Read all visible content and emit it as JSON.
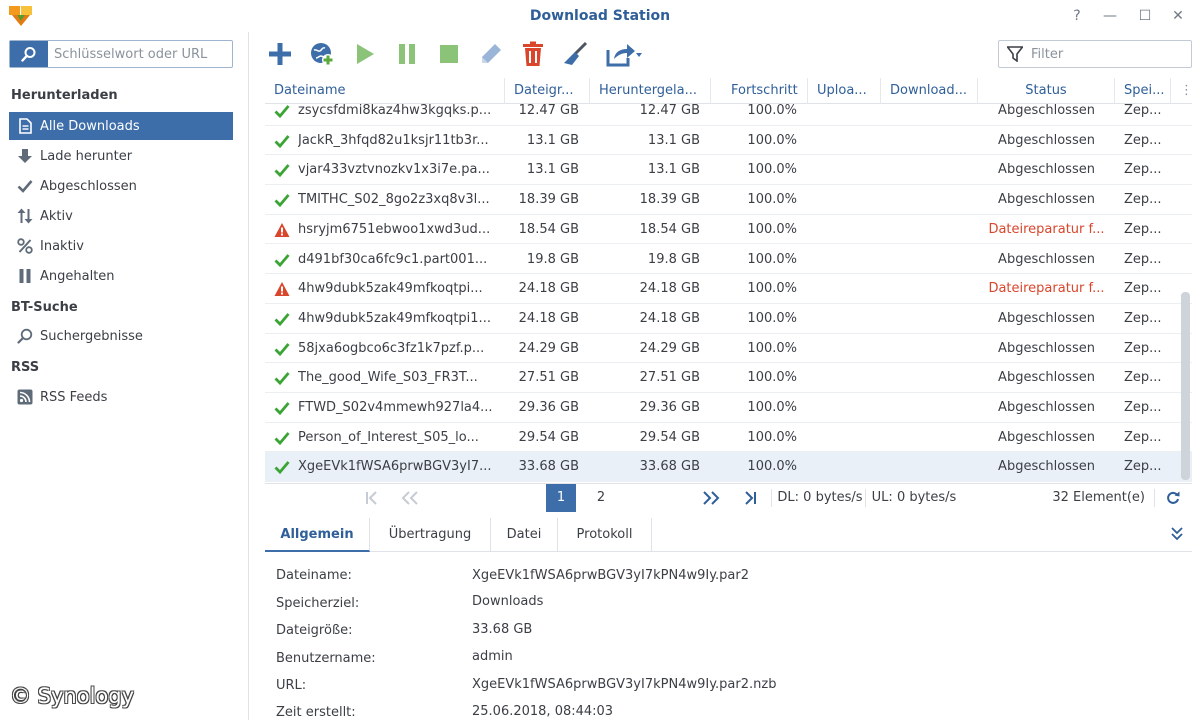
{
  "app": {
    "title": "Download Station",
    "window_buttons": {
      "help": "?",
      "minimize": "—",
      "maximize": "☐",
      "close": "✕"
    }
  },
  "search": {
    "placeholder": "Schlüsselwort oder URL"
  },
  "sidebar": {
    "sections": [
      {
        "label": "Herunterladen"
      },
      {
        "label": "BT-Suche"
      },
      {
        "label": "RSS"
      }
    ],
    "items": [
      {
        "label": "Alle Downloads",
        "icon": "document-icon"
      },
      {
        "label": "Lade herunter",
        "icon": "arrow-down-icon"
      },
      {
        "label": "Abgeschlossen",
        "icon": "checkmark-icon"
      },
      {
        "label": "Aktiv",
        "icon": "up-down-arrows-icon"
      },
      {
        "label": "Inaktiv",
        "icon": "percent-icon"
      },
      {
        "label": "Angehalten",
        "icon": "pause-icon"
      },
      {
        "label": "Suchergebnisse",
        "icon": "magnifier-icon"
      },
      {
        "label": "RSS Feeds",
        "icon": "rss-icon"
      }
    ],
    "active_item": "Alle Downloads"
  },
  "toolbar": {
    "buttons": [
      "add-icon",
      "add-url-icon",
      "resume-icon",
      "pause-icon",
      "stop-icon",
      "edit-icon",
      "delete-icon",
      "clear-completed-icon",
      "share-icon"
    ],
    "filter_placeholder": "Filter"
  },
  "grid": {
    "columns": [
      "Dateiname",
      "Dateigr...",
      "Heruntergela...",
      "Fortschritt",
      "Uploa...",
      "Download...",
      "Status",
      "Spei..."
    ],
    "rows": [
      {
        "name": "zsycsfdmi8kaz4hw3kgqks.p...",
        "size": "12.47 GB",
        "downloaded": "12.47 GB",
        "progress": "100.0%",
        "upload": "",
        "download": "",
        "status": "Abgeschlossen",
        "dest": "Zep...",
        "state": "ok"
      },
      {
        "name": "JackR_3hfqd82u1ksjr11tb3r...",
        "size": "13.1 GB",
        "downloaded": "13.1 GB",
        "progress": "100.0%",
        "upload": "",
        "download": "",
        "status": "Abgeschlossen",
        "dest": "Zep...",
        "state": "ok"
      },
      {
        "name": "vjar433vztvnozkv1x3i7e.pa...",
        "size": "13.1 GB",
        "downloaded": "13.1 GB",
        "progress": "100.0%",
        "upload": "",
        "download": "",
        "status": "Abgeschlossen",
        "dest": "Zep...",
        "state": "ok"
      },
      {
        "name": "TMITHC_S02_8go2z3xq8v3l...",
        "size": "18.39 GB",
        "downloaded": "18.39 GB",
        "progress": "100.0%",
        "upload": "",
        "download": "",
        "status": "Abgeschlossen",
        "dest": "Zep...",
        "state": "ok"
      },
      {
        "name": "hsryjm6751ebwoo1xwd3ud...",
        "size": "18.54 GB",
        "downloaded": "18.54 GB",
        "progress": "100.0%",
        "upload": "",
        "download": "",
        "status": "Dateireparatur f...",
        "dest": "Zep...",
        "state": "error"
      },
      {
        "name": "d491bf30ca6fc9c1.part001...",
        "size": "19.8 GB",
        "downloaded": "19.8 GB",
        "progress": "100.0%",
        "upload": "",
        "download": "",
        "status": "Abgeschlossen",
        "dest": "Zep...",
        "state": "ok"
      },
      {
        "name": "4hw9dubk5zak49mfkoqtpi...",
        "size": "24.18 GB",
        "downloaded": "24.18 GB",
        "progress": "100.0%",
        "upload": "",
        "download": "",
        "status": "Dateireparatur f...",
        "dest": "Zep...",
        "state": "error"
      },
      {
        "name": "4hw9dubk5zak49mfkoqtpi1...",
        "size": "24.18 GB",
        "downloaded": "24.18 GB",
        "progress": "100.0%",
        "upload": "",
        "download": "",
        "status": "Abgeschlossen",
        "dest": "Zep...",
        "state": "ok"
      },
      {
        "name": "58jxa6ogbco6c3fz1k7pzf.p...",
        "size": "24.29 GB",
        "downloaded": "24.29 GB",
        "progress": "100.0%",
        "upload": "",
        "download": "",
        "status": "Abgeschlossen",
        "dest": "Zep...",
        "state": "ok"
      },
      {
        "name": "The_good_Wife_S03_FR3T...",
        "size": "27.51 GB",
        "downloaded": "27.51 GB",
        "progress": "100.0%",
        "upload": "",
        "download": "",
        "status": "Abgeschlossen",
        "dest": "Zep...",
        "state": "ok"
      },
      {
        "name": "FTWD_S02v4mmewh927la4...",
        "size": "29.36 GB",
        "downloaded": "29.36 GB",
        "progress": "100.0%",
        "upload": "",
        "download": "",
        "status": "Abgeschlossen",
        "dest": "Zep...",
        "state": "ok"
      },
      {
        "name": "Person_of_Interest_S05_lo...",
        "size": "29.54 GB",
        "downloaded": "29.54 GB",
        "progress": "100.0%",
        "upload": "",
        "download": "",
        "status": "Abgeschlossen",
        "dest": "Zep...",
        "state": "ok"
      },
      {
        "name": "XgeEVk1fWSA6prwBGV3yI7...",
        "size": "33.68 GB",
        "downloaded": "33.68 GB",
        "progress": "100.0%",
        "upload": "",
        "download": "",
        "status": "Abgeschlossen",
        "dest": "Zep...",
        "state": "ok",
        "selected": true
      }
    ]
  },
  "pager": {
    "pages": [
      "1",
      "2"
    ],
    "current": "1",
    "dl_speed": "DL: 0 bytes/s",
    "ul_speed": "UL: 0 bytes/s",
    "count": "32 Element(e)"
  },
  "detail": {
    "tabs": [
      "Allgemein",
      "Übertragung",
      "Datei",
      "Protokoll"
    ],
    "active_tab": "Allgemein",
    "fields": [
      {
        "label": "Dateiname:",
        "value": "XgeEVk1fWSA6prwBGV3yI7kPN4w9Iy.par2"
      },
      {
        "label": "Speicherziel:",
        "value": "Downloads"
      },
      {
        "label": "Dateigröße:",
        "value": "33.68 GB"
      },
      {
        "label": "Benutzername:",
        "value": "admin"
      },
      {
        "label": "URL:",
        "value": "XgeEVk1fWSA6prwBGV3yI7kPN4w9Iy.par2.nzb"
      },
      {
        "label": "Zeit erstellt:",
        "value": "25.06.2018, 08:44:03"
      }
    ]
  },
  "watermark": "© Synology",
  "colors": {
    "accent": "#3e6ea9",
    "title": "#2f5f98",
    "success": "#3aa534",
    "error": "#d9462c"
  }
}
